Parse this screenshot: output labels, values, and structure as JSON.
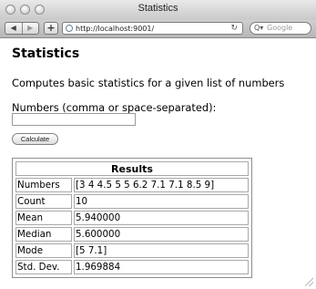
{
  "window": {
    "title": "Statistics"
  },
  "toolbar": {
    "back_icon": "◀",
    "forward_icon": "▶",
    "add_icon": "+",
    "url": "http://localhost:9001/",
    "reload_icon": "↻",
    "search_icon": "Q▾",
    "search_placeholder": "Google"
  },
  "page": {
    "title": "Statistics",
    "description": "Computes basic statistics for a given list of numbers",
    "input_label": "Numbers (comma or space-separated):",
    "input_value": "",
    "calculate_label": "Calculate"
  },
  "results": {
    "header": "Results",
    "rows": [
      {
        "label": "Numbers",
        "value": "[3 4 4.5 5 5 6.2 7.1 7.1 8.5 9]"
      },
      {
        "label": "Count",
        "value": "10"
      },
      {
        "label": "Mean",
        "value": "5.940000"
      },
      {
        "label": "Median",
        "value": "5.600000"
      },
      {
        "label": "Mode",
        "value": "[5 7.1]"
      },
      {
        "label": "Std. Dev.",
        "value": "1.969884"
      }
    ]
  }
}
